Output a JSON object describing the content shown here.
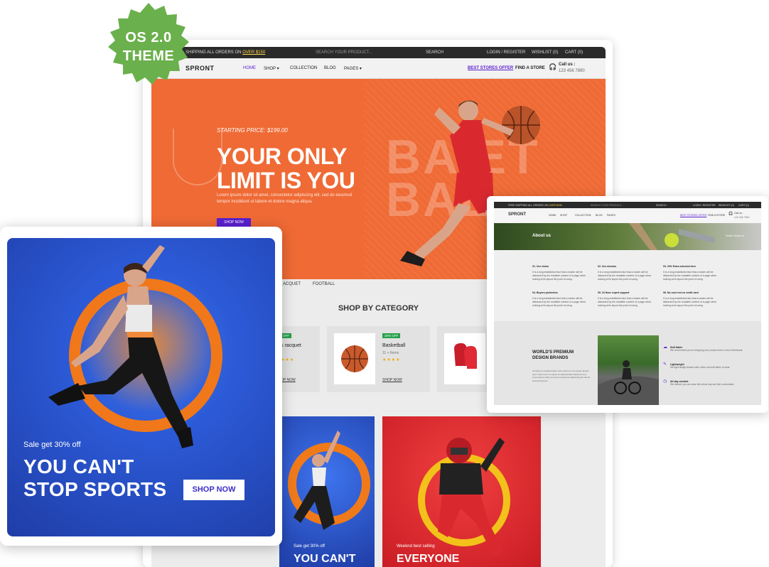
{
  "badge": {
    "line1": "OS 2.0",
    "line2": "THEME"
  },
  "main": {
    "topbar": {
      "shipping": "SHIPPING ALL ORDERS ON",
      "shipping_link": "OVER $150",
      "search_placeholder": "SEARCH YOUR PRODUCT...",
      "search_label": "SEARCH",
      "login": "LOGIN / REGISTER",
      "wishlist": "WISHLIST (0)",
      "cart": "CART (0)"
    },
    "nav": {
      "logo": "SPRONT",
      "items": [
        "HOME",
        "SHOP",
        "COLLECTION",
        "BLOG",
        "PAGES"
      ],
      "best_stores": "BEST STORES OFFER",
      "find_store": "FIND A STORE",
      "call_label": "Call us :",
      "call_number": "123 456 7890"
    },
    "hero": {
      "price": "STARTING PRICE: $199.00",
      "title_line1": "YOUR ONLY",
      "title_line2": "LIMIT IS YOU",
      "paragraph": "Lorem ipsum dolor sit amet, consectetur adipiscing elit, sed do eiusmod tempor incididunt ut labore et dolore magna aliqua.",
      "button": "SHOP NOW",
      "ghost_text": "BA ET BAL"
    },
    "tabs": [
      "ACQUET",
      "FOOTBALL"
    ],
    "shop_by_category": "SHOP BY CATEGORY",
    "categories": [
      {
        "badge": "OFF",
        "name": "s racquet",
        "link": "OP NOW"
      },
      {
        "badge": "20% OFF",
        "name": "Basketball",
        "items": "11 + Items",
        "stars": "★★★★",
        "link": "SHOP NOW"
      }
    ],
    "promos": [
      {
        "sub": "Sale get 30% off",
        "title": "YOU CAN'T"
      },
      {
        "sub": "Weeknd best selling",
        "title": "EVERYONE"
      }
    ]
  },
  "left_card": {
    "sale": "Sale get 30% off",
    "line1": "YOU CAN'T",
    "line2": "STOP SPORTS",
    "button": "SHOP NOW"
  },
  "right_card": {
    "topbar": {
      "shipping": "FREE SHIPPING ALL ORDERS ON",
      "shipping_link": "OVER $150",
      "search": "SEARCH YOUR PRODUCT...",
      "search_btn": "SEARCH",
      "login": "LOGIN / REGISTER",
      "wishlist": "WISHLIST (0)",
      "cart": "CART (0)"
    },
    "nav": {
      "logo": "SPRONT",
      "items": [
        "HOME",
        "SHOP",
        "COLLECTION",
        "BLOG",
        "PAGES"
      ],
      "best": "BEST STORES OFFER",
      "find": "FIND A STORE",
      "call": "Call us :",
      "number": "123 456 7890"
    },
    "banner": {
      "title": "About us",
      "breadcrumb": "Home / About us"
    },
    "info": [
      {
        "title": "01. Our vision",
        "text": "It is a long established fact that a reader will be distracted by the readable content of a page when looking at its layout the point of using."
      },
      {
        "title": "02. Our mission",
        "text": "It is a long established fact that a reader will be distracted by the readable content of a page when looking at its layout the point of using."
      },
      {
        "title": "03. 20% Extra selected item",
        "text": "It is a long established fact that a reader will be distracted by the readable content of a page when looking at its layout the point of using."
      },
      {
        "title": "04. Buyers protection",
        "text": "It is a long established fact that a reader will be distracted by the readable content of a page when looking at its layout the point of using."
      },
      {
        "title": "05. 24 Hour expert support",
        "text": "It is a long established fact that a reader will be distracted by the readable content of a page when looking at its layout the point of using."
      },
      {
        "title": "06. No cost emi on credit card",
        "text": "It is a long established fact that a reader will be distracted by the readable content of a page when looking at its layout the point of using."
      }
    ],
    "brands": {
      "title": "WORLD'S PREMIUM DESIGN BRANDS",
      "text": "Contrary to popular belief, lorem ipsum is not simply random text. It has roots in a piece of classical latin literature from. Lorem ipsum dolor sit amet consectetur adipiscing elit sed do eiusmod tempor."
    },
    "features": [
      {
        "title": "Soft fabric",
        "text": "We recommend you to shopping over product here in best Streetwear."
      },
      {
        "title": "Lightweight",
        "text": "We light weight feature with cotton and soft fabric to wear."
      },
      {
        "title": "All day comfort",
        "text": "We believe you can wear this whole day and feel comfortable."
      }
    ]
  },
  "colors": {
    "hero": "#ef6a35",
    "accent": "#5a1fd1",
    "seal": "#6ab04c",
    "promo_blue": "#2c5ad7",
    "promo_red": "#e52d2d"
  }
}
